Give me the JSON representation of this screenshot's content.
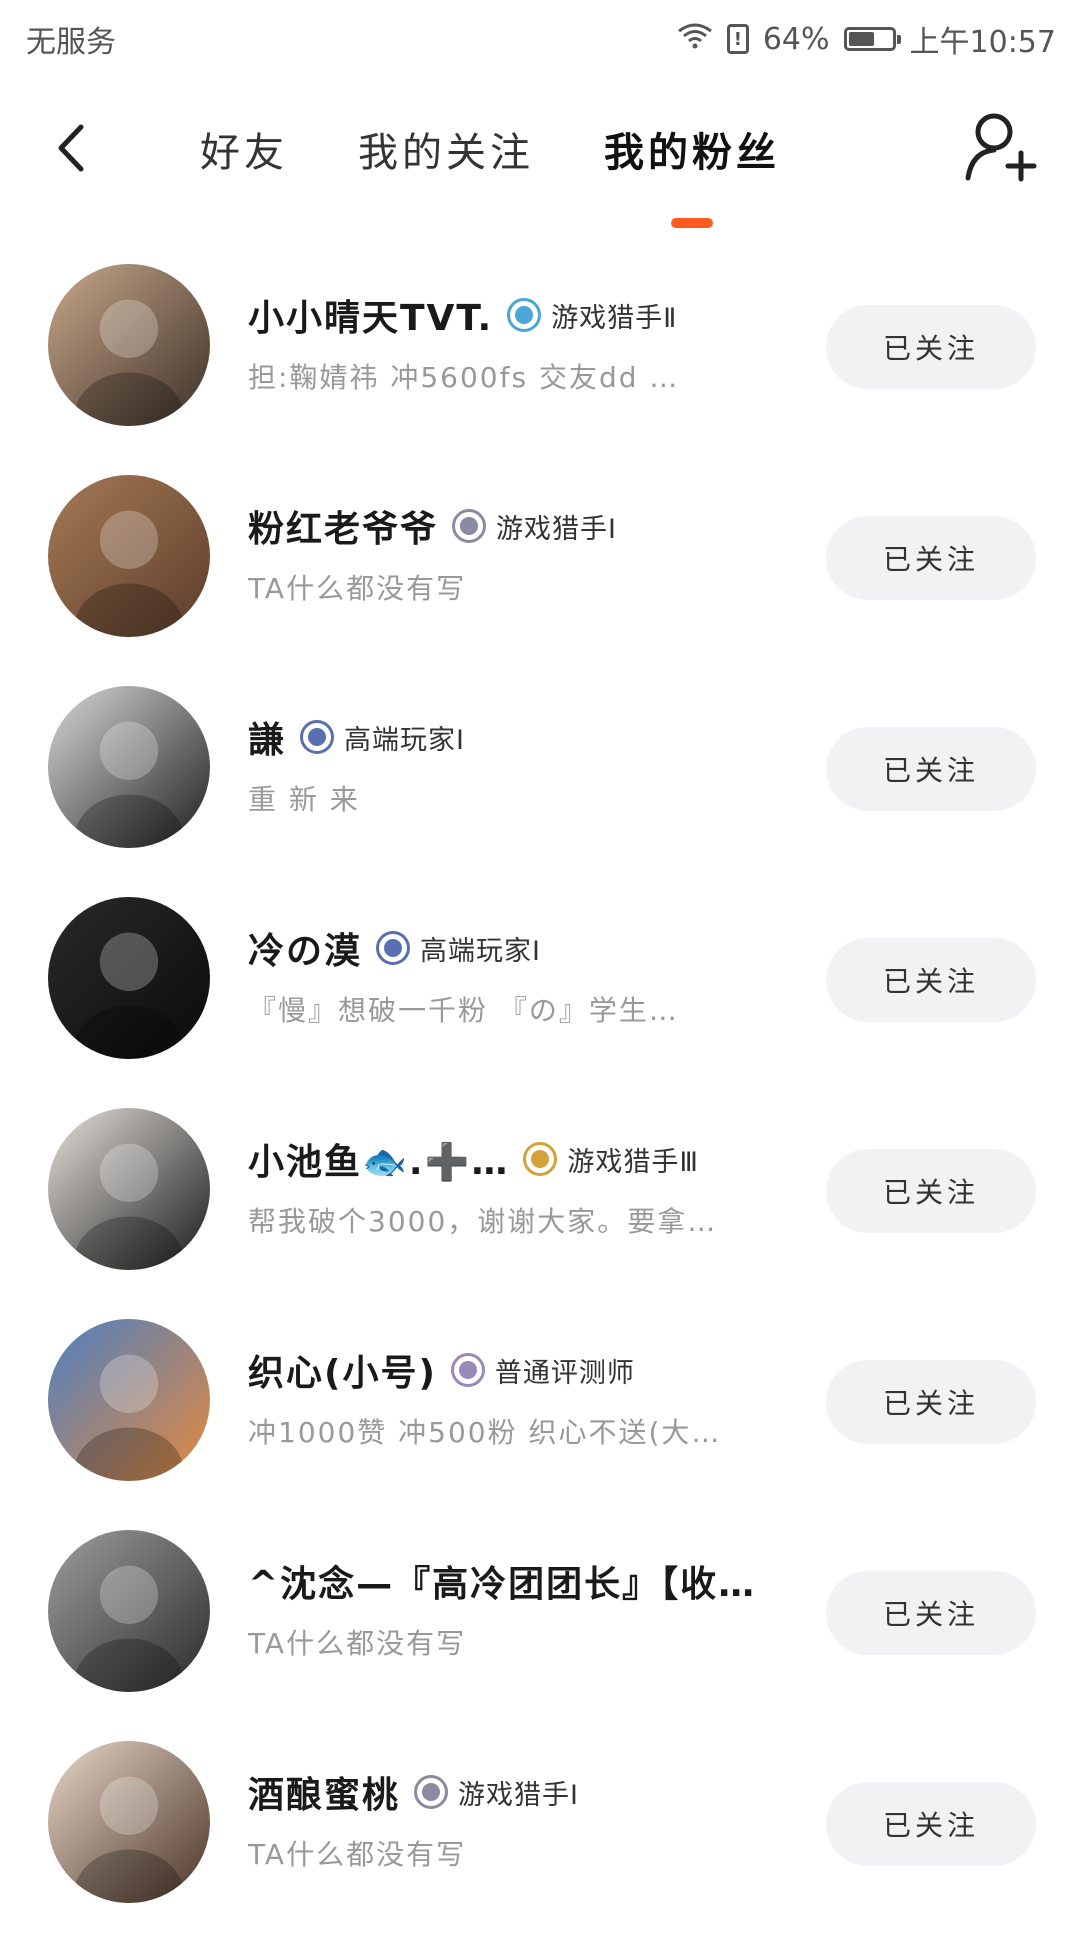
{
  "status_bar": {
    "carrier": "无服务",
    "battery_percent": "64%",
    "battery_level": 0.64,
    "time": "上午10:57"
  },
  "header": {
    "tabs": [
      {
        "label": "好友",
        "active": false
      },
      {
        "label": "我的关注",
        "active": false
      },
      {
        "label": "我的粉丝",
        "active": true
      }
    ],
    "accent_color": "#ff5a1f"
  },
  "followers": [
    {
      "name": "小小晴天TVT.",
      "badge": "游戏猎手Ⅱ",
      "bio": "担:鞠婧祎  冲5600fs  交友dd …",
      "button": "已关注",
      "badge_color": "#4aa6d6",
      "avatar_colors": [
        "#c9a98a",
        "#3c2f28"
      ]
    },
    {
      "name": "粉红老爷爷",
      "badge": "游戏猎手Ⅰ",
      "bio": "TA什么都没有写",
      "button": "已关注",
      "badge_color": "#8a8aa0",
      "avatar_colors": [
        "#a67a55",
        "#5b3d2b"
      ]
    },
    {
      "name": "謙",
      "badge": "高端玩家Ⅰ",
      "bio": "重  新  来",
      "button": "已关注",
      "badge_color": "#5a6fb0",
      "avatar_colors": [
        "#d9d9d9",
        "#1e1e1e"
      ]
    },
    {
      "name": "冷の漠",
      "badge": "高端玩家Ⅰ",
      "bio": "『慢』想破一千粉 『の』学生…",
      "button": "已关注",
      "badge_color": "#5a6fb0",
      "avatar_colors": [
        "#2a2a2a",
        "#0a0a0a"
      ]
    },
    {
      "name": "小池鱼🐟.➕…",
      "badge": "游戏猎手Ⅲ",
      "bio": "帮我破个3000，谢谢大家。要拿…",
      "button": "已关注",
      "badge_color": "#d4a13a",
      "avatar_colors": [
        "#e6e2dc",
        "#1a1a1a"
      ]
    },
    {
      "name": "织心(小号)",
      "badge": "普通评测师",
      "bio": "冲1000赞 冲500粉 织心不送(大…",
      "button": "已关注",
      "badge_color": "#9a8ab8",
      "avatar_colors": [
        "#4d7fc4",
        "#e58a3c"
      ]
    },
    {
      "name": "^沈念—『高冷团团长』【收…",
      "badge": "",
      "bio": "TA什么都没有写",
      "button": "已关注",
      "badge_color": "",
      "avatar_colors": [
        "#9e9e9e",
        "#2b2b2b"
      ]
    },
    {
      "name": "酒酿蜜桃",
      "badge": "游戏猎手Ⅰ",
      "bio": "TA什么都没有写",
      "button": "已关注",
      "badge_color": "#8a8aa0",
      "avatar_colors": [
        "#e8d7c8",
        "#4a3326"
      ]
    }
  ]
}
